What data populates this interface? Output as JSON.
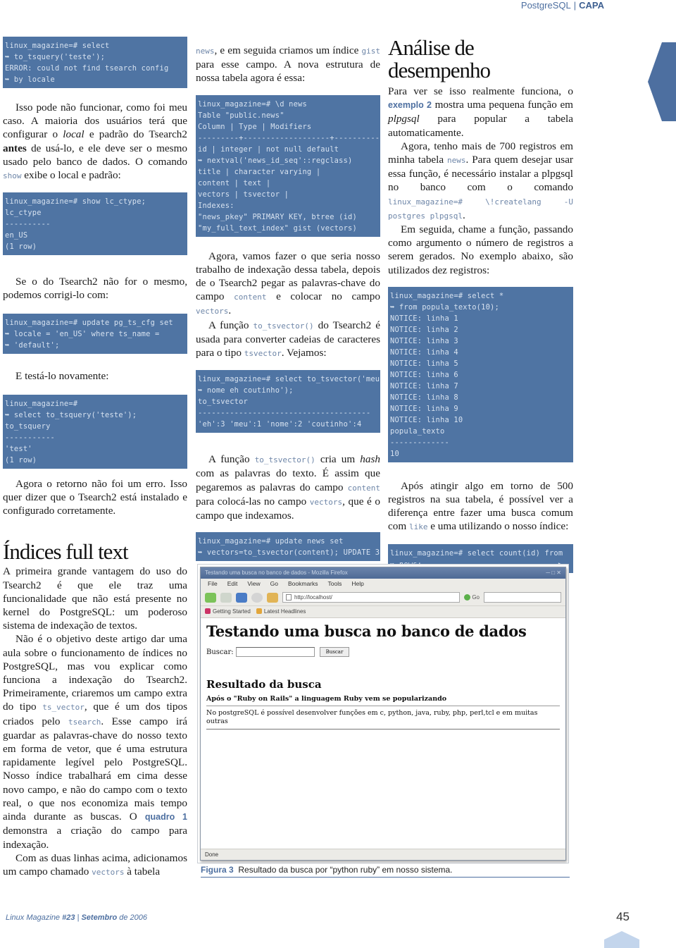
{
  "header": {
    "section": "PostgreSQL",
    "category": "CAPA"
  },
  "colors": {
    "accent": "#4d6fa0",
    "code_bg": "#4f74a3",
    "code_fg": "#d7e2f0",
    "tab_light": "#c3d5ec"
  },
  "col1": {
    "code1": [
      "linux_magazine=# select",
      "➥ to_tsquery('teste');",
      "ERROR: could not find tsearch config",
      "➥ by locale"
    ],
    "p1_a": "Isso pode não funcionar, como foi meu caso. A maioria dos usuários terá que configurar o ",
    "p1_i1": "local",
    "p1_b": " e padrão do Tsearch2 ",
    "p1_strong": "antes",
    "p1_c": " de usá-lo, e ele deve ser o mesmo usado pelo banco de dados. O comando ",
    "p1_code": "show",
    "p1_d": " exibe o local e padrão:",
    "code2": [
      "linux_magazine=# show lc_ctype;",
      "lc_ctype",
      "----------",
      "en_US",
      "(1 row)"
    ],
    "p2": "Se o do Tsearch2 não for o mesmo, podemos corrigi-lo com:",
    "code3": [
      "linux_magazine=# update pg_ts_cfg set",
      "➥ locale = 'en_US' where ts_name =",
      "➥ 'default';"
    ],
    "p3": "E testá-lo novamente:",
    "code4": [
      "linux_magazine=#",
      "➥ select to_tsquery('teste');",
      "to_tsquery",
      "-----------",
      "'test'",
      "(1 row)"
    ],
    "p4": "Agora o retorno não foi um erro. Isso quer dizer que o Tsearch2 está instalado e configurado corretamente.",
    "h_indices": "Índices full text",
    "p5": "A primeira grande vantagem do uso do Tsearch2 é que ele traz uma funcionalidade que não está presente no kernel do PostgreSQL: um poderoso sistema de indexação de textos.",
    "p6_a": "Não é o objetivo deste artigo dar uma aula sobre o funcionamento de índices no PostgreSQL, mas vou explicar como funciona a indexação do Tsearch2. Primeiramente, criaremos um campo extra do tipo ",
    "p6_code1": "ts_vector",
    "p6_b": ", que é um dos tipos criados pelo ",
    "p6_code2": "tsearch",
    "p6_c": ". Esse campo irá guardar as palavras-chave do nosso texto em forma de vetor, que é uma estrutura rapidamente legível pelo PostgreSQL. Nosso índice trabalhará em cima desse novo campo, e não do campo com o texto real, o que nos economiza mais tempo ainda durante as buscas. O ",
    "p6_ref": "quadro 1",
    "p6_d": " demonstra a criação do campo para indexação.",
    "p7_a": "Com as duas linhas acima, adicionamos um campo chamado ",
    "p7_code": "vectors",
    "p7_b": " à tabela"
  },
  "col2": {
    "p1_code1": "news",
    "p1_a": ", e em seguida criamos um índice ",
    "p1_code2": "gist",
    "p1_b": " para esse campo. A nova estrutura de nossa tabela agora é essa:",
    "code1": [
      "linux_magazine=# \\d news",
      "Table \"public.news\"",
      "Column | Type | Modifiers",
      "---------+-------------------+-------------",
      "id | integer | not null default",
      "➥ nextval('news_id_seq'::regclass)",
      "title | character varying |",
      "content | text |",
      "vectors | tsvector |",
      "Indexes:",
      "\"news_pkey\" PRIMARY KEY, btree (id)",
      "\"my_full_text_index\" gist (vectors)"
    ],
    "p2_a": "Agora, vamos fazer o que seria nosso trabalho de indexação dessa tabela, depois de o Tsearch2 pegar as palavras-chave do campo ",
    "p2_code1": "content",
    "p2_b": " e colocar no campo ",
    "p2_code2": "vectors",
    "p2_c": ".",
    "p3_a": "A função ",
    "p3_code1": "to_tsvector()",
    "p3_b": " do Tsearch2 é usada para converter cadeias de caracteres para o tipo ",
    "p3_code2": "tsvector",
    "p3_c": ". Vejamos:",
    "code2": [
      "linux_magazine=# select to_tsvector('meu",
      "➥ nome eh coutinho');",
      "to_tsvector",
      "--------------------------------------",
      "'eh':3 'meu':1 'nome':2 'coutinho':4"
    ],
    "p4_a": "A função ",
    "p4_code1": "to_tsvector()",
    "p4_b": " cria um ",
    "p4_i": "hash",
    "p4_c": " com as palavras do texto. É assim que pegaremos as palavras do campo ",
    "p4_code2": "content",
    "p4_d": " para colocá-las no campo ",
    "p4_code3": "vectors",
    "p4_e": ", que é o campo que indexamos.",
    "code3": [
      "linux_magazine=# update news set",
      "➥ vectors=to_tsvector(content); UPDATE 3"
    ]
  },
  "col3": {
    "h_analise": "Análise de desempenho",
    "p1_a": "Para ver se isso realmente funciona, o ",
    "p1_ref": "exemplo 2",
    "p1_b": " mostra uma pequena função em ",
    "p1_i": "plpgsql",
    "p1_c": " para popular a tabela automaticamente.",
    "p2_a": "Agora, tenho mais de 700 registros em minha tabela ",
    "p2_code1": "news",
    "p2_b": ". Para quem desejar usar essa função, é necessário instalar a plpgsql no banco com o comando ",
    "p2_code2": "linux_magazine=# \\!createlang -U postgres plpgsql",
    "p2_c": ".",
    "p3": "Em seguida, chame a função, passando como argumento o número de registros a serem gerados. No exemplo abaixo, são utilizados dez registros:",
    "code1": [
      "linux_magazine=# select *",
      "➥ from popula_texto(10);",
      "NOTICE: linha 1",
      "NOTICE: linha 2",
      "NOTICE: linha 3",
      "NOTICE: linha 4",
      "NOTICE: linha 5",
      "NOTICE: linha 6",
      "NOTICE: linha 7",
      "NOTICE: linha 8",
      "NOTICE: linha 9",
      "NOTICE: linha 10",
      "popula_texto",
      "-------------",
      "10"
    ],
    "p4_a": "Após atingir algo em torno de 500 registros na sua tabela, é possível ver a diferença entre fazer uma busca comum com ",
    "p4_code": "like",
    "p4_b": " e uma utilizando o nosso índice:",
    "code2": [
      "linux_magazine=# select count(id) from",
      "➥ news;                              ▶"
    ]
  },
  "figure": {
    "browser": {
      "window_title": "Testando uma busca no banco de dados - Mozilla Firefox",
      "menu": [
        "File",
        "Edit",
        "View",
        "Go",
        "Bookmarks",
        "Tools",
        "Help"
      ],
      "url": "http://localhost/",
      "go_label": "Go",
      "bookmarks": [
        "Getting Started",
        "Latest Headlines"
      ],
      "page_title": "Testando uma busca no banco de dados",
      "search_label": "Buscar:",
      "search_value": "",
      "search_button": "Buscar",
      "results_title": "Resultado da busca",
      "results": [
        "Após o \"Ruby on Rails\" a linguagem Ruby vem se popularizando",
        "No postgreSQL é possível desenvolver funções em c, python, java, ruby, php, perl,tcl e em muitas outras"
      ],
      "status": "Done"
    },
    "caption_label": "Figura 3",
    "caption_text": "Resultado da busca por “python ruby” em nosso sistema."
  },
  "footer": {
    "magazine": "Linux Magazine ",
    "issue": "#23",
    "sep": " | ",
    "month": "Setembro",
    "year": " de 2006",
    "page": "45"
  }
}
